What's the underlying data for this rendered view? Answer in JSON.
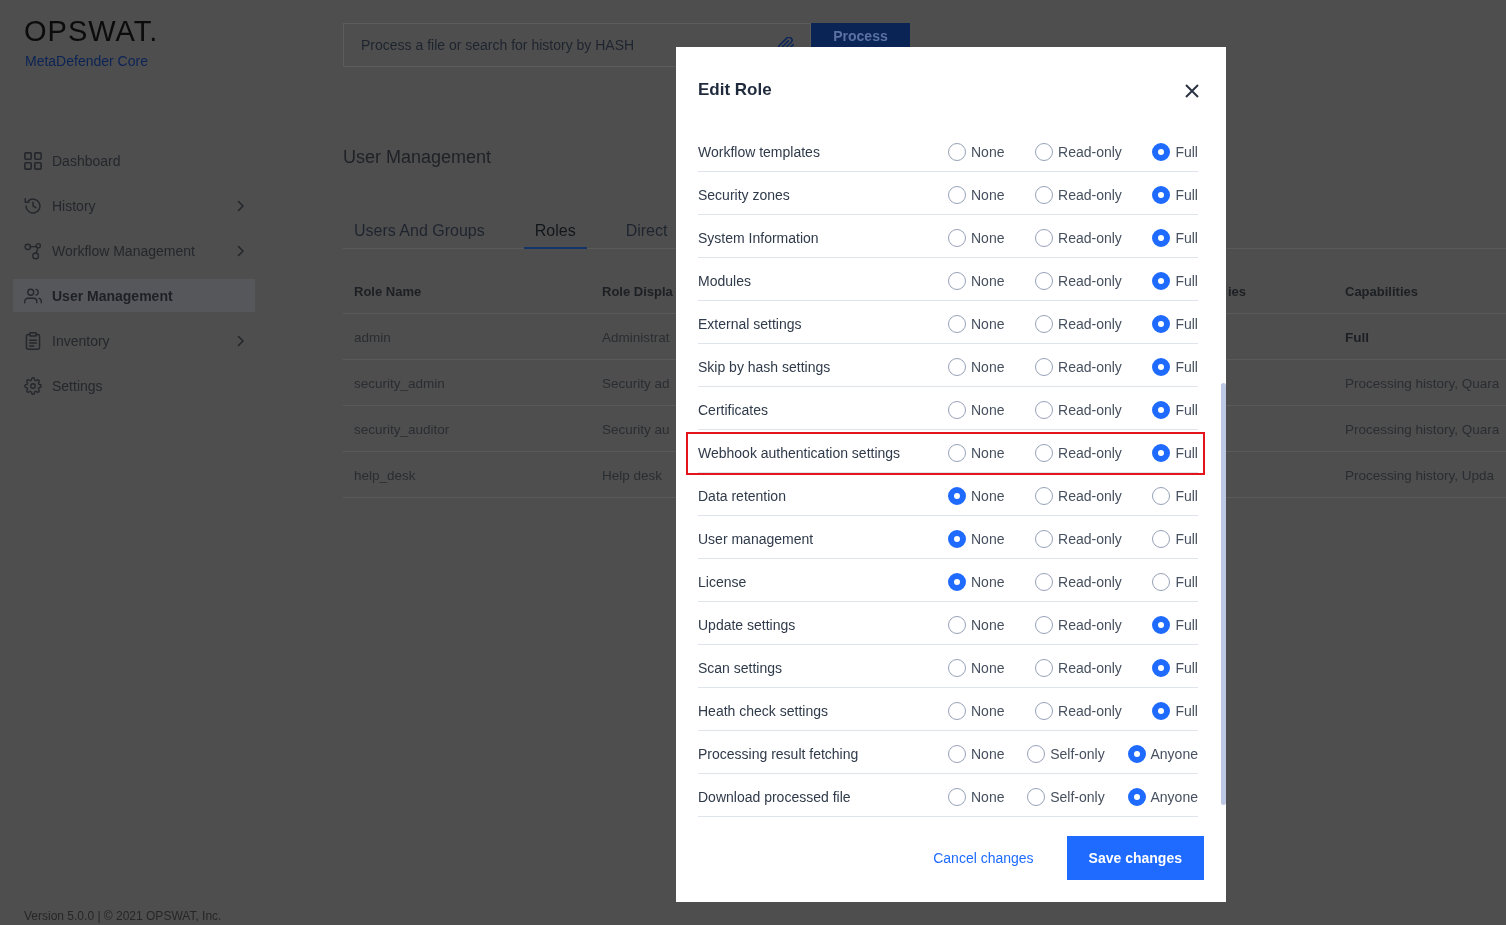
{
  "sidebar": {
    "logo": "OPSWAT.",
    "product": "MetaDefender Core",
    "items": [
      {
        "label": "Dashboard",
        "has_submenu": false,
        "selected": false
      },
      {
        "label": "History",
        "has_submenu": true,
        "selected": false
      },
      {
        "label": "Workflow Management",
        "has_submenu": true,
        "selected": false
      },
      {
        "label": "User Management",
        "has_submenu": false,
        "selected": true
      },
      {
        "label": "Inventory",
        "has_submenu": true,
        "selected": false
      },
      {
        "label": "Settings",
        "has_submenu": false,
        "selected": false
      }
    ]
  },
  "search": {
    "placeholder": "Process a file or search for history by HASH",
    "button": "Process"
  },
  "page_title": "User Management",
  "tabs": [
    {
      "label": "Users And Groups",
      "selected": false
    },
    {
      "label": "Roles",
      "selected": true
    },
    {
      "label": "Direct",
      "selected": false
    }
  ],
  "table": {
    "columns": [
      "Role Name",
      "Role Displa",
      "ies",
      "Capabilities"
    ],
    "rows": [
      {
        "role_name": "admin",
        "column_2": "Administrat",
        "capabilities": "Full",
        "capabilities_bold": true
      },
      {
        "role_name": "security_admin",
        "column_2": "Security ad",
        "capabilities": "Processing history, Quara",
        "capabilities_bold": false
      },
      {
        "role_name": "security_auditor",
        "column_2": "Security au",
        "capabilities": "Processing history, Quara",
        "capabilities_bold": false
      },
      {
        "role_name": "help_desk",
        "column_2": "Help desk",
        "capabilities": "Processing history, Upda",
        "capabilities_bold": false
      }
    ]
  },
  "modal": {
    "title": "Edit Role",
    "rows": [
      {
        "label": "Workflow templates",
        "highlighted": false,
        "options": [
          {
            "label": "None",
            "selected": false
          },
          {
            "label": "Read-only",
            "selected": false
          },
          {
            "label": "Full",
            "selected": true
          }
        ]
      },
      {
        "label": "Security zones",
        "highlighted": false,
        "options": [
          {
            "label": "None",
            "selected": false
          },
          {
            "label": "Read-only",
            "selected": false
          },
          {
            "label": "Full",
            "selected": true
          }
        ]
      },
      {
        "label": "System Information",
        "highlighted": false,
        "options": [
          {
            "label": "None",
            "selected": false
          },
          {
            "label": "Read-only",
            "selected": false
          },
          {
            "label": "Full",
            "selected": true
          }
        ]
      },
      {
        "label": "Modules",
        "highlighted": false,
        "options": [
          {
            "label": "None",
            "selected": false
          },
          {
            "label": "Read-only",
            "selected": false
          },
          {
            "label": "Full",
            "selected": true
          }
        ]
      },
      {
        "label": "External settings",
        "highlighted": false,
        "options": [
          {
            "label": "None",
            "selected": false
          },
          {
            "label": "Read-only",
            "selected": false
          },
          {
            "label": "Full",
            "selected": true
          }
        ]
      },
      {
        "label": "Skip by hash settings",
        "highlighted": false,
        "options": [
          {
            "label": "None",
            "selected": false
          },
          {
            "label": "Read-only",
            "selected": false
          },
          {
            "label": "Full",
            "selected": true
          }
        ]
      },
      {
        "label": "Certificates",
        "highlighted": false,
        "options": [
          {
            "label": "None",
            "selected": false
          },
          {
            "label": "Read-only",
            "selected": false
          },
          {
            "label": "Full",
            "selected": true
          }
        ]
      },
      {
        "label": "Webhook authentication settings",
        "highlighted": true,
        "options": [
          {
            "label": "None",
            "selected": false
          },
          {
            "label": "Read-only",
            "selected": false
          },
          {
            "label": "Full",
            "selected": true
          }
        ]
      },
      {
        "label": "Data retention",
        "highlighted": false,
        "options": [
          {
            "label": "None",
            "selected": true
          },
          {
            "label": "Read-only",
            "selected": false
          },
          {
            "label": "Full",
            "selected": false
          }
        ]
      },
      {
        "label": "User management",
        "highlighted": false,
        "options": [
          {
            "label": "None",
            "selected": true
          },
          {
            "label": "Read-only",
            "selected": false
          },
          {
            "label": "Full",
            "selected": false
          }
        ]
      },
      {
        "label": "License",
        "highlighted": false,
        "options": [
          {
            "label": "None",
            "selected": true
          },
          {
            "label": "Read-only",
            "selected": false
          },
          {
            "label": "Full",
            "selected": false
          }
        ]
      },
      {
        "label": "Update settings",
        "highlighted": false,
        "options": [
          {
            "label": "None",
            "selected": false
          },
          {
            "label": "Read-only",
            "selected": false
          },
          {
            "label": "Full",
            "selected": true
          }
        ]
      },
      {
        "label": "Scan settings",
        "highlighted": false,
        "options": [
          {
            "label": "None",
            "selected": false
          },
          {
            "label": "Read-only",
            "selected": false
          },
          {
            "label": "Full",
            "selected": true
          }
        ]
      },
      {
        "label": "Heath check settings",
        "highlighted": false,
        "options": [
          {
            "label": "None",
            "selected": false
          },
          {
            "label": "Read-only",
            "selected": false
          },
          {
            "label": "Full",
            "selected": true
          }
        ]
      },
      {
        "label": "Processing result fetching",
        "highlighted": false,
        "options": [
          {
            "label": "None",
            "selected": false
          },
          {
            "label": "Self-only",
            "selected": false
          },
          {
            "label": "Anyone",
            "selected": true
          }
        ]
      },
      {
        "label": "Download processed file",
        "highlighted": false,
        "options": [
          {
            "label": "None",
            "selected": false
          },
          {
            "label": "Self-only",
            "selected": false
          },
          {
            "label": "Anyone",
            "selected": true
          }
        ]
      }
    ],
    "cancel": "Cancel changes",
    "save": "Save changes"
  },
  "footer": {
    "version": "Version 5.0.0 | © 2021 OPSWAT, Inc."
  }
}
